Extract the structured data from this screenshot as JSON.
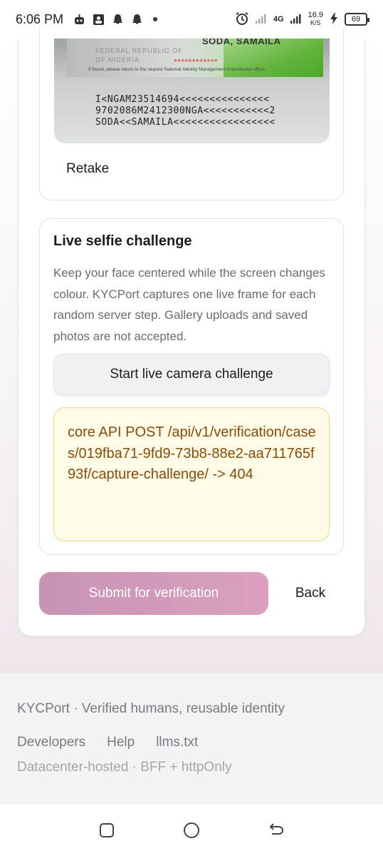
{
  "status_bar": {
    "time": "6:06 PM",
    "network": "4G",
    "net_speed_value": "16.9",
    "net_speed_unit": "K/S",
    "battery": "69",
    "icons": [
      "robot-icon",
      "contacts-icon",
      "snapchat-icon",
      "snapchat-icon",
      "dot-icon",
      "alarm-icon",
      "signal-icon",
      "charging-icon",
      "battery-icon"
    ]
  },
  "id_card": {
    "name_line": "SODA, SAMAILA",
    "header_line_1": "FEDERAL REPUBLIC OF",
    "header_line_2": "OF NIGERIA",
    "stars": "************",
    "note": "If found, please return to the nearest National Identity Management Commission office.",
    "mrz_line_1": "I<NGAM23514694<<<<<<<<<<<<<<<",
    "mrz_line_2": "9702086M2412300NGA<<<<<<<<<<<2",
    "mrz_line_3": "SODA<<SAMAILA<<<<<<<<<<<<<<<<<",
    "retake_label": "Retake"
  },
  "selfie": {
    "title": "Live selfie challenge",
    "description": "Keep your face centered while the screen changes colour. KYCPort captures one live frame for each random server step. Gallery uploads and saved photos are not accepted.",
    "button_label": "Start live camera challenge",
    "error_message": "core API POST /api/v1/verification/cases/019fba71-9fd9-73b8-88e2-aa711765f93f/capture-challenge/ -> 404"
  },
  "actions": {
    "submit_label": "Submit for verification",
    "back_label": "Back"
  },
  "footer": {
    "tagline": "KYCPort · Verified humans, reusable identity",
    "links": [
      "Developers",
      "Help",
      "llms.txt"
    ],
    "hosting": "Datacenter-hosted · BFF + httpOnly"
  },
  "nav_bar": {
    "icons": [
      "recents-icon",
      "home-icon",
      "back-icon"
    ]
  },
  "colors": {
    "submit_gradient_start": "#c893b3",
    "submit_gradient_end": "#dba0bf",
    "error_bg": "#fffbe6",
    "error_border": "#f0d98a",
    "error_text": "#8a4a0a"
  }
}
